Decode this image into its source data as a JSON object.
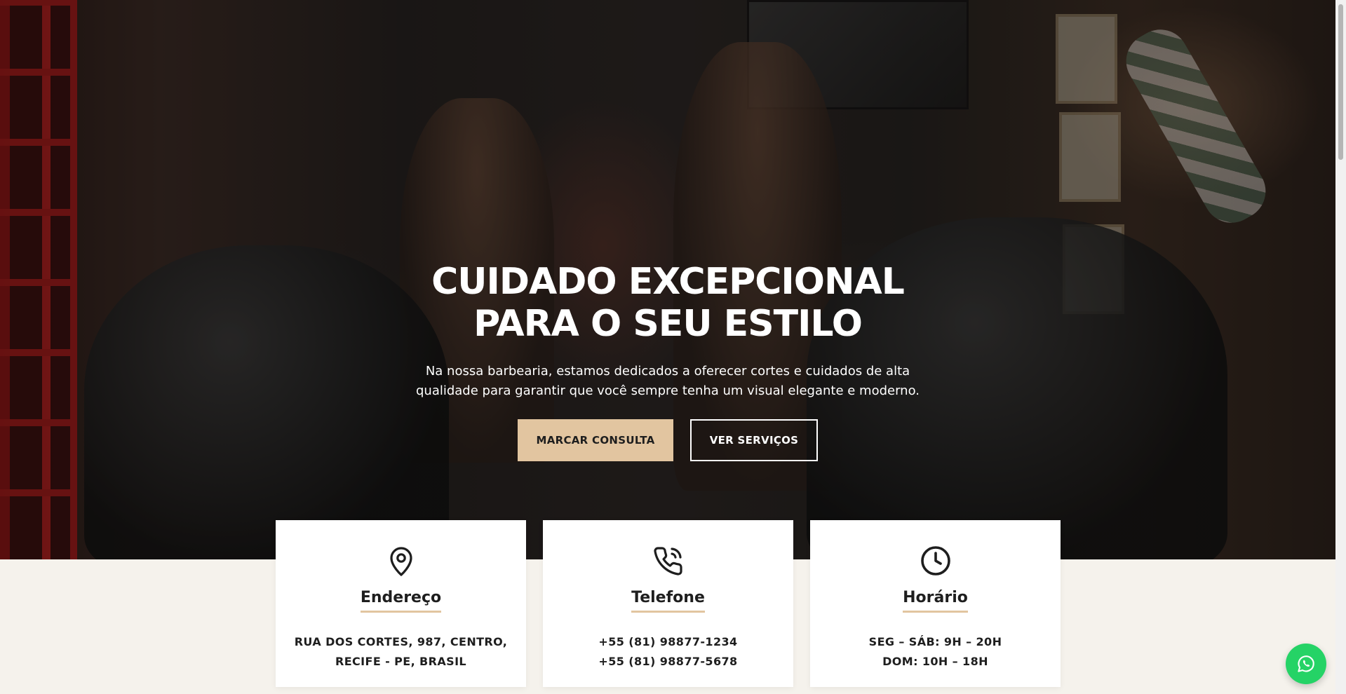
{
  "hero": {
    "title_line1": "CUIDADO EXCEPCIONAL",
    "title_line2": "PARA O SEU ESTILO",
    "subtitle": "Na nossa barbearia, estamos dedicados a oferecer cortes e cuidados de alta qualidade para garantir que você sempre tenha um visual elegante e moderno.",
    "primary_button": "MARCAR CONSULTA",
    "secondary_button": "VER SERVIÇOS"
  },
  "cards": [
    {
      "icon": "map-pin-icon",
      "title": "Endereço",
      "lines": [
        "RUA DOS CORTES, 987, CENTRO,",
        "RECIFE - PE, BRASIL"
      ]
    },
    {
      "icon": "phone-icon",
      "title": "Telefone",
      "lines": [
        "+55 (81) 98877-1234",
        "+55 (81) 98877-5678"
      ]
    },
    {
      "icon": "clock-icon",
      "title": "Horário",
      "lines": [
        "SEG – SÁB: 9H – 20H",
        "DOM: 10H – 18H"
      ]
    }
  ],
  "floating": {
    "icon": "whatsapp-icon"
  },
  "colors": {
    "accent": "#e2c5a0",
    "whatsapp": "#25d366",
    "section_bg": "#f5f2ec"
  }
}
